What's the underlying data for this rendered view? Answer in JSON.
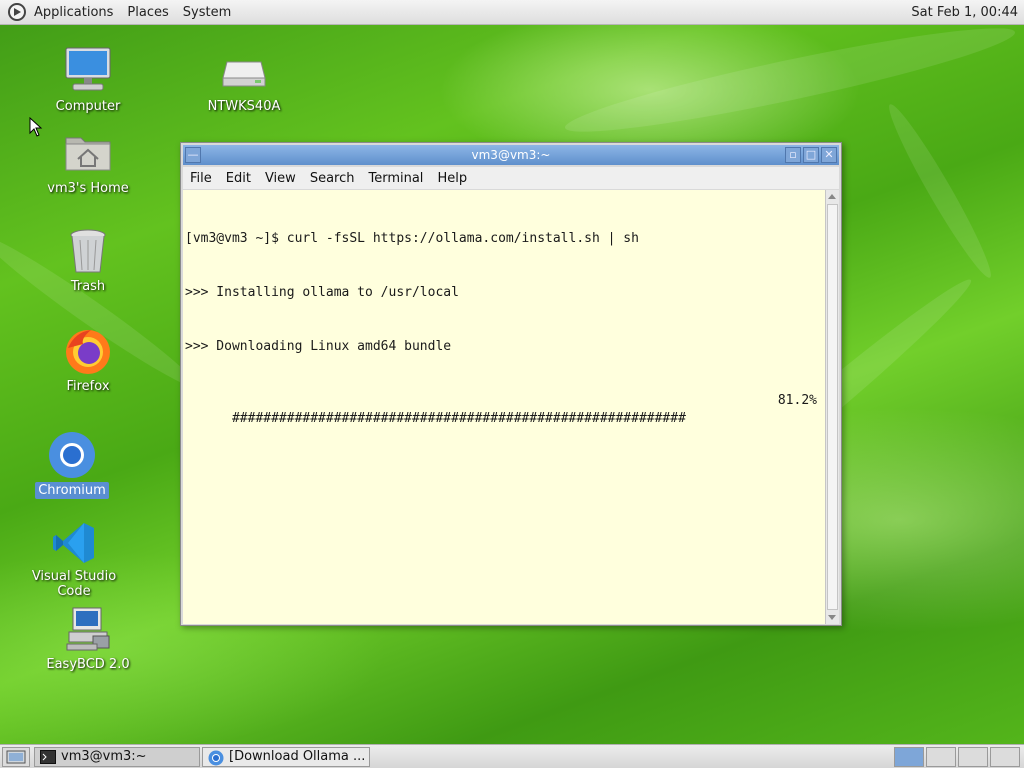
{
  "top_panel": {
    "menus": [
      "Applications",
      "Places",
      "System"
    ],
    "clock": "Sat Feb  1, 00:44"
  },
  "desktop_icons": [
    {
      "label": "Computer",
      "icon": "computer-icon"
    },
    {
      "label": "NTWKS40A",
      "icon": "drive-icon"
    },
    {
      "label": "vm3's Home",
      "icon": "home-folder-icon"
    },
    {
      "label": "Trash",
      "icon": "trash-icon"
    },
    {
      "label": "Firefox",
      "icon": "firefox-icon"
    },
    {
      "label": "Chromium",
      "icon": "chromium-icon",
      "selected": true
    },
    {
      "label": "Visual Studio Code",
      "icon": "vscode-icon"
    },
    {
      "label": "EasyBCD 2.0",
      "icon": "easybcd-icon"
    }
  ],
  "terminal": {
    "title": "vm3@vm3:~",
    "menu": [
      "File",
      "Edit",
      "View",
      "Search",
      "Terminal",
      "Help"
    ],
    "lines": [
      "[vm3@vm3 ~]$ curl -fsSL https://ollama.com/install.sh | sh",
      ">>> Installing ollama to /usr/local",
      ">>> Downloading Linux amd64 bundle"
    ],
    "progress_bar": "##########################################################",
    "progress_percent": "81.2%",
    "progress_value": 81.2
  },
  "taskbar": {
    "tasks": [
      {
        "label": "vm3@vm3:~",
        "icon": "terminal-icon"
      },
      {
        "label": "[Download Ollama ...",
        "icon": "chromium-icon"
      }
    ]
  },
  "colors": {
    "terminal_bg": "#ffffdd",
    "titlebar": "#6f9bd6",
    "selection": "#5a8fd2",
    "desktop_green": "#56b81c"
  }
}
